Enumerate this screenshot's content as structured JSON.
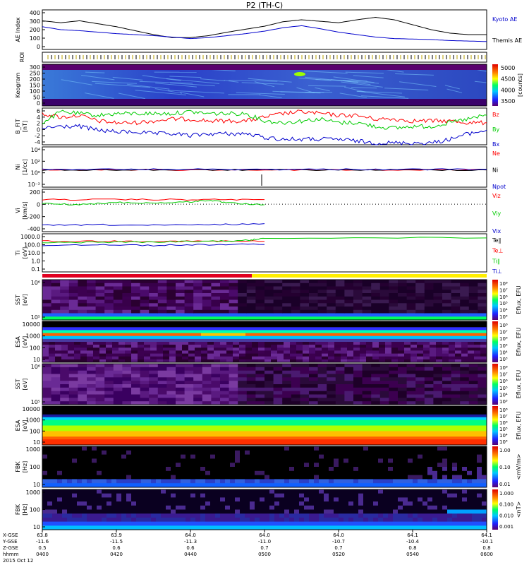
{
  "title": "P2 (TH-C)",
  "chart_data": [
    {
      "type": "line",
      "panel": "ae",
      "ylabel": "AE Index",
      "yticks": [
        "400",
        "300",
        "200",
        "100",
        "0"
      ],
      "ylim": [
        0,
        400
      ],
      "xlim": [
        0,
        120
      ],
      "series": [
        {
          "name": "Kyoto AE",
          "color": "#000000",
          "x": [
            0,
            5,
            10,
            15,
            20,
            25,
            30,
            35,
            40,
            45,
            50,
            55,
            60,
            65,
            70,
            75,
            80,
            85,
            90,
            95,
            100,
            105,
            110,
            115,
            120
          ],
          "y": [
            290,
            270,
            290,
            260,
            230,
            190,
            150,
            120,
            120,
            140,
            175,
            205,
            235,
            280,
            300,
            285,
            270,
            300,
            325,
            300,
            250,
            200,
            165,
            150,
            150
          ]
        },
        {
          "name": "Themis AE",
          "color": "#0000cc",
          "x": [
            0,
            5,
            10,
            15,
            20,
            25,
            30,
            35,
            40,
            45,
            50,
            55,
            60,
            65,
            70,
            75,
            80,
            85,
            90,
            95,
            100,
            105,
            110,
            115,
            120
          ],
          "y": [
            230,
            200,
            190,
            175,
            160,
            150,
            140,
            125,
            110,
            120,
            140,
            160,
            185,
            220,
            240,
            210,
            175,
            150,
            125,
            110,
            105,
            100,
            90,
            85,
            80
          ]
        }
      ]
    },
    {
      "type": "table",
      "panel": "roi",
      "ylabel": "ROI"
    },
    {
      "type": "heatmap",
      "panel": "keogram",
      "ylabel": "Keogram",
      "yticks": [
        "300",
        "250",
        "200",
        "150",
        "100",
        "50",
        "0"
      ],
      "colorbar": {
        "label": "[counts]",
        "ticks": [
          "5000",
          "4500",
          "4000",
          "3500"
        ]
      }
    },
    {
      "type": "line",
      "panel": "bfield",
      "ylabel": "B_FIT",
      "units": "[nT]",
      "yticks": [
        "6",
        "4",
        "2",
        "0",
        "-2",
        "-4"
      ],
      "ylim": [
        -4,
        6
      ],
      "xlim": [
        0,
        120
      ],
      "series": [
        {
          "name": "Bz",
          "color": "#ff0000",
          "x": [
            0,
            5,
            10,
            15,
            20,
            25,
            30,
            35,
            40,
            45,
            50,
            55,
            60,
            65,
            70,
            75,
            80,
            85,
            90,
            95,
            100,
            105,
            110,
            115,
            120
          ],
          "y": [
            4.5,
            3.5,
            4,
            2.5,
            2,
            2,
            2.5,
            3,
            3,
            2.5,
            2.5,
            2.5,
            3.5,
            4.5,
            5,
            4.5,
            4,
            4,
            3,
            3,
            2.5,
            2.5,
            2.5,
            2,
            2
          ]
        },
        {
          "name": "By",
          "color": "#00cc00",
          "x": [
            0,
            5,
            10,
            15,
            20,
            25,
            30,
            35,
            40,
            45,
            50,
            55,
            60,
            65,
            70,
            75,
            80,
            85,
            90,
            95,
            100,
            105,
            110,
            115,
            120
          ],
          "y": [
            2,
            5,
            4.5,
            4,
            4.5,
            4.5,
            4.5,
            4.5,
            5,
            4.5,
            4.5,
            4.5,
            2.5,
            2,
            2.5,
            3,
            2,
            2,
            1,
            0.5,
            1,
            1,
            2,
            3,
            4
          ]
        },
        {
          "name": "Bx",
          "color": "#0000cc",
          "x": [
            0,
            5,
            10,
            15,
            20,
            25,
            30,
            35,
            40,
            45,
            50,
            55,
            60,
            65,
            70,
            75,
            80,
            85,
            90,
            95,
            100,
            105,
            110,
            115,
            120
          ],
          "y": [
            0.5,
            1,
            1,
            0,
            -0.5,
            -0.5,
            -1,
            -1,
            -1.5,
            -1,
            -1,
            -1,
            -2,
            -2.5,
            -2.5,
            -2.5,
            -2.5,
            -3,
            -3.5,
            -3.5,
            -3.5,
            -3.5,
            -2.5,
            -1,
            0
          ]
        }
      ]
    },
    {
      "type": "line",
      "panel": "density",
      "ylabel": "Ni",
      "units": "[1/cc]",
      "yticks": [
        "10⁴",
        "10²",
        "10⁰",
        "10⁻²"
      ],
      "ylim": [
        -3,
        4
      ],
      "scale": "log",
      "xlim": [
        0,
        120
      ],
      "series": [
        {
          "name": "Ne",
          "color": "#ff0000",
          "x": [
            0,
            20,
            40,
            60,
            80,
            100,
            120
          ],
          "y": [
            0,
            0,
            0,
            0,
            0,
            0,
            0
          ]
        },
        {
          "name": "Ni",
          "color": "#000000",
          "x": [
            0,
            20,
            40,
            60,
            80,
            100,
            120
          ],
          "y": [
            0,
            0,
            0,
            0,
            0,
            0,
            0
          ]
        },
        {
          "name": "Npot",
          "color": "#0000cc",
          "x": [
            0,
            20,
            40,
            60,
            80,
            100,
            120
          ],
          "y": [
            0.1,
            0.1,
            0.1,
            0.1,
            0.1,
            0.1,
            0.1
          ]
        }
      ],
      "legend": [
        "Ne",
        "Ni",
        "Npot"
      ]
    },
    {
      "type": "line",
      "panel": "velocity",
      "ylabel": "Vi",
      "units": "[km/s]",
      "yticks": [
        "200",
        "0",
        "-200",
        "-400"
      ],
      "ylim": [
        -480,
        260
      ],
      "xlim": [
        0,
        120
      ],
      "series": [
        {
          "name": "Viz",
          "color": "#ff0000",
          "x": [
            0,
            15,
            30,
            45,
            60
          ],
          "y": [
            80,
            80,
            80,
            80,
            80
          ]
        },
        {
          "name": "Viy",
          "color": "#00cc00",
          "x": [
            0,
            10,
            20,
            30,
            40,
            45,
            50,
            60
          ],
          "y": [
            10,
            -10,
            30,
            20,
            40,
            70,
            20,
            -10
          ]
        },
        {
          "name": "Vix",
          "color": "#0000cc",
          "x": [
            0,
            15,
            30,
            45,
            60
          ],
          "y": [
            -370,
            -360,
            -370,
            -360,
            -340
          ]
        }
      ]
    },
    {
      "type": "line",
      "panel": "temperature",
      "ylabel": "Ti",
      "units": "[eV]",
      "yticks": [
        "1000.0",
        "100.0",
        "10.0",
        "1.0",
        "0.1"
      ],
      "ylim": [
        -1.2,
        3.4
      ],
      "scale": "log",
      "xlim": [
        0,
        120
      ],
      "series": [
        {
          "name": "Te⊥",
          "color": "#ff0000",
          "x": [
            0,
            15,
            30,
            45,
            60
          ],
          "y": [
            2.5,
            2.5,
            2.5,
            2.5,
            2.5
          ]
        },
        {
          "name": "Ti∥",
          "color": "#00cc00",
          "x": [
            0,
            15,
            30,
            45,
            56,
            60,
            120
          ],
          "y": [
            2.3,
            2.4,
            2.4,
            2.5,
            2.6,
            2.9,
            2.9
          ]
        },
        {
          "name": "Ti⊥",
          "color": "#0000cc",
          "x": [
            0,
            15,
            30,
            45,
            60
          ],
          "y": [
            2.0,
            2.1,
            2.0,
            2.1,
            2.1
          ]
        }
      ],
      "legend": [
        "Te∥",
        "Te⊥",
        "Ti∥",
        "Ti⊥"
      ]
    },
    {
      "type": "table",
      "panel": "mode",
      "ylabel": ""
    },
    {
      "type": "heatmap",
      "panel": "sst_i",
      "ylabel": "SST",
      "units": "[eV]",
      "yticks": [
        "10⁶",
        "10⁵"
      ],
      "colorbar": {
        "label": "Eflux, EFU",
        "ticks": [
          "10⁸",
          "10⁷",
          "10⁶",
          "10⁵",
          "10⁴",
          "10³"
        ]
      }
    },
    {
      "type": "heatmap",
      "panel": "esa_i",
      "ylabel": "ESA",
      "units": "[eV]",
      "yticks": [
        "10000",
        "1000",
        "100",
        "10"
      ],
      "colorbar": {
        "label": "Eflux, EFU",
        "ticks": [
          "10⁸",
          "10⁷",
          "10⁶",
          "10⁵",
          "10⁴",
          "10³"
        ]
      }
    },
    {
      "type": "heatmap",
      "panel": "sst_e",
      "ylabel": "SST",
      "units": "[eV]",
      "yticks": [
        "10⁶",
        "10⁵"
      ],
      "colorbar": {
        "label": "Eflux, EFU",
        "ticks": [
          "10⁸",
          "10⁷",
          "10⁶",
          "10⁵",
          "10⁴",
          "10³"
        ]
      }
    },
    {
      "type": "heatmap",
      "panel": "esa_e",
      "ylabel": "ESA",
      "units": "[eV]",
      "yticks": [
        "10000",
        "1000",
        "100",
        "10"
      ],
      "colorbar": {
        "label": "Eflux, EFU",
        "ticks": [
          "10⁸",
          "10⁷",
          "10⁶",
          "10⁵",
          "10⁴",
          "10³"
        ]
      }
    },
    {
      "type": "heatmap",
      "panel": "fbk_e",
      "ylabel": "FBK",
      "units": "[Hz]",
      "yticks": [
        "1000",
        "100",
        "10"
      ],
      "colorbar": {
        "label": "<mV/m>",
        "ticks": [
          "1.00",
          "0.10",
          "0.01"
        ]
      }
    },
    {
      "type": "heatmap",
      "panel": "fbk_b",
      "ylabel": "FBK",
      "units": "[Hz]",
      "yticks": [
        "1000",
        "100",
        "10"
      ],
      "colorbar": {
        "label": "<nT>",
        "ticks": [
          "1.000",
          "0.100",
          "0.010",
          "0.001"
        ]
      }
    }
  ],
  "x_axis": {
    "rows": [
      "X-GSE",
      "Y-GSE",
      "Z-GSE",
      "hhmm",
      "2015 Oct 12"
    ],
    "ticks": [
      {
        "x": [
          "63.8",
          "-11.6",
          "0.5",
          "0400"
        ]
      },
      {
        "x": [
          "63.9",
          "-11.5",
          "0.6",
          "0420"
        ]
      },
      {
        "x": [
          "64.0",
          "-11.3",
          "0.6",
          "0440"
        ]
      },
      {
        "x": [
          "64.0",
          "-11.0",
          "0.7",
          "0500"
        ]
      },
      {
        "x": [
          "64.0",
          "-10.7",
          "0.7",
          "0520"
        ]
      },
      {
        "x": [
          "64.1",
          "-10.4",
          "0.8",
          "0540"
        ]
      },
      {
        "x": [
          "64.1",
          "-10.1",
          "0.8",
          "0600"
        ]
      }
    ]
  }
}
